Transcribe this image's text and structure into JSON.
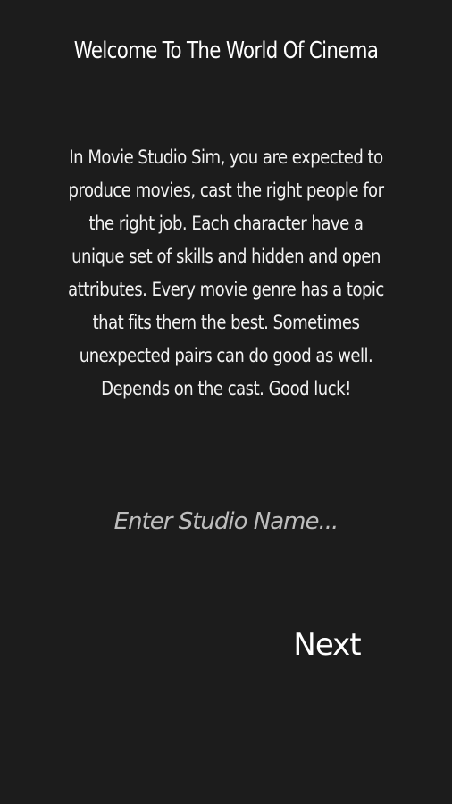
{
  "screen": {
    "title": "Welcome To The World Of Cinema",
    "intro_text": "In Movie Studio Sim, you are expected to produce movies, cast the right people for the right job. Each character have a unique set of skills and hidden and open attributes. Every movie genre has a topic that fits them the best. Sometimes unexpected pairs can do good as well. Depends on the cast. Good luck!",
    "studio_name_input": {
      "value": "",
      "placeholder": "Enter Studio Name..."
    },
    "next_label": "Next"
  },
  "colors": {
    "background": "#1c1c1c",
    "text": "#ffffff",
    "placeholder": "#bdbdbd"
  }
}
